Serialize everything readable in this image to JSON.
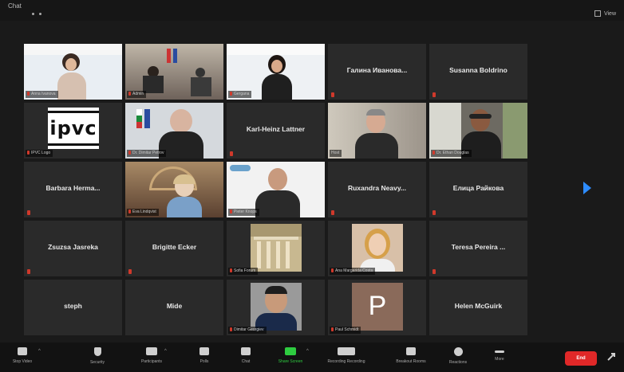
{
  "window": {
    "title": "Chat",
    "view_label": "View"
  },
  "tiles": [
    {
      "name": "",
      "tag": "Anna Ivanova"
    },
    {
      "name": "",
      "tag": "Admin"
    },
    {
      "name": "",
      "tag": "Gergana"
    },
    {
      "name": "Галина Иванова...",
      "tag": ""
    },
    {
      "name": "Susanna Boldrino",
      "tag": ""
    },
    {
      "name": "",
      "tag": "IPVC Logo"
    },
    {
      "name": "",
      "tag": "Dr. Dimitar Petrov"
    },
    {
      "name": "Karl-Heinz Lattner",
      "tag": ""
    },
    {
      "name": "",
      "tag": "Host"
    },
    {
      "name": "",
      "tag": "Dr. Ethan Douglas"
    },
    {
      "name": "Barbara Herma...",
      "tag": ""
    },
    {
      "name": "",
      "tag": "Eva Lindqvist"
    },
    {
      "name": "",
      "tag": "Pieter Knops"
    },
    {
      "name": "Ruxandra Neavy...",
      "tag": ""
    },
    {
      "name": "Елица Райкова",
      "tag": ""
    },
    {
      "name": "Zsuzsa Jasreka",
      "tag": ""
    },
    {
      "name": "Brigitte Ecker",
      "tag": ""
    },
    {
      "name": "",
      "tag": "Sofia Forum"
    },
    {
      "name": "",
      "tag": "Ana Margarida Costa"
    },
    {
      "name": "Teresa Pereira ...",
      "tag": ""
    },
    {
      "name": "steph",
      "tag": ""
    },
    {
      "name": "Mide",
      "tag": ""
    },
    {
      "name": "",
      "tag": "Dimitar Georgiev"
    },
    {
      "name": "",
      "tag": "Paul Schmidt"
    },
    {
      "name": "Helen McGuirk",
      "tag": ""
    }
  ],
  "avatar_letter": "P",
  "logo_text": "ipvc",
  "toolbar": [
    {
      "label": "Stop Video",
      "icon": "video-icon"
    },
    {
      "label": "Security",
      "icon": "shield-icon"
    },
    {
      "label": "Participants",
      "icon": "participants-icon"
    },
    {
      "label": "Polls",
      "icon": "polls-icon"
    },
    {
      "label": "Chat",
      "icon": "chat-icon"
    },
    {
      "label": "Share Screen",
      "icon": "share-screen-icon"
    },
    {
      "label": "Recording Recording",
      "icon": "record-icon"
    },
    {
      "label": "Breakout Rooms",
      "icon": "breakout-icon"
    },
    {
      "label": "Reactions",
      "icon": "reactions-icon"
    },
    {
      "label": "More",
      "icon": "more-icon"
    }
  ],
  "end_label": "End",
  "colors": {
    "share_green": "#2ecc40",
    "end_red": "#e02828",
    "active_border": "#9bc53d",
    "arrow_blue": "#2d8cff"
  }
}
